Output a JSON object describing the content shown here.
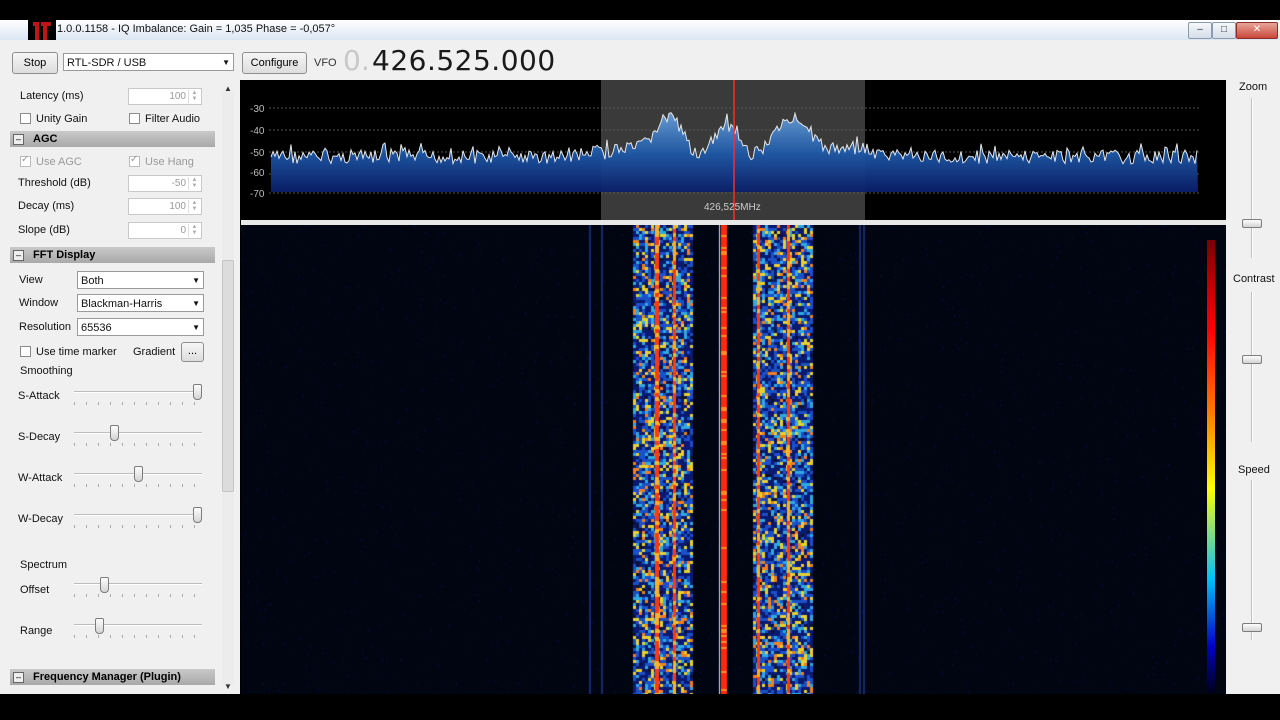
{
  "window": {
    "title": "1.0.0.1158 - IQ Imbalance: Gain = 1,035 Phase = -0,057°",
    "controls": [
      "minimize",
      "maximize",
      "close"
    ]
  },
  "toolbar": {
    "stop_label": "Stop",
    "device": "RTL-SDR / USB",
    "configure_label": "Configure",
    "vfo_label": "VFO",
    "vfo_prefix": "0.",
    "vfo_frequency": "426.525.000"
  },
  "audio": {
    "latency_label": "Latency (ms)",
    "latency_value": "100",
    "unity_gain_label": "Unity Gain",
    "filter_audio_label": "Filter Audio"
  },
  "agc": {
    "header": "AGC",
    "use_agc_label": "Use AGC",
    "use_hang_label": "Use Hang",
    "threshold_label": "Threshold (dB)",
    "threshold_value": "-50",
    "decay_label": "Decay (ms)",
    "decay_value": "100",
    "slope_label": "Slope (dB)",
    "slope_value": "0"
  },
  "fft": {
    "header": "FFT Display",
    "view_label": "View",
    "view_value": "Both",
    "window_label": "Window",
    "window_value": "Blackman-Harris",
    "resolution_label": "Resolution",
    "resolution_value": "65536",
    "time_marker_label": "Use time marker",
    "gradient_label": "Gradient",
    "gradient_button": "...",
    "smoothing_label": "Smoothing",
    "s_attack_label": "S-Attack",
    "s_decay_label": "S-Decay",
    "w_attack_label": "W-Attack",
    "w_decay_label": "W-Decay",
    "spectrum_label": "Spectrum",
    "offset_label": "Offset",
    "range_label": "Range",
    "s_attack_level": 1.0,
    "s_decay_level": 0.3,
    "w_attack_level": 0.5,
    "w_decay_level": 1.0,
    "offset_level": 0.22,
    "range_level": 0.18
  },
  "freq_manager": {
    "header": "Frequency Manager (Plugin)"
  },
  "spectrum": {
    "db_labels": [
      "-30",
      "-40",
      "-50",
      "-60",
      "-70"
    ],
    "center_label": "426,525MHz",
    "colors": {
      "fill": "#1f5aa8",
      "trace": "#e6e6e6",
      "marker": "#ff2a2a",
      "passband": "#3a3a3a"
    }
  },
  "rightpanel": {
    "zoom_label": "Zoom",
    "contrast_label": "Contrast",
    "speed_label": "Speed",
    "zoom_level": 0.8,
    "contrast_level": 0.45,
    "speed_level": 0.95
  }
}
